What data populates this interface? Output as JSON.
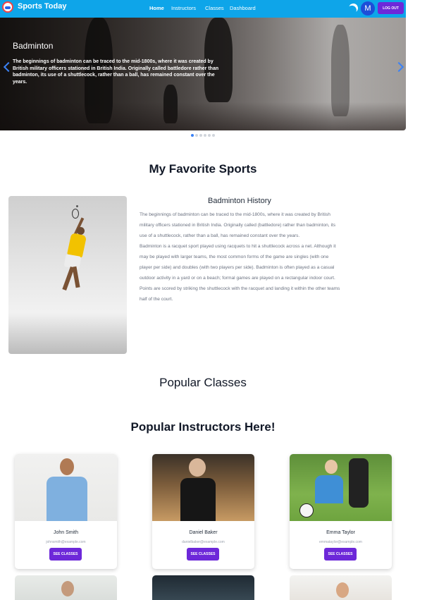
{
  "navbar": {
    "brand": "Sports Today",
    "links": [
      "Home",
      "Instructors",
      "Classes",
      "Dashboard"
    ],
    "avatar_letter": "M",
    "logout_label": "LOG OUT"
  },
  "hero": {
    "title": "Badminton",
    "text": "The beginnings of badminton can be traced to the mid-1800s, where it was created by British military officers stationed in British India. Originally called battledore rather than badminton, its use of a shuttlecock, rather than a ball, has remained constant over the years.",
    "slide_count": 6,
    "active_slide": 1
  },
  "favorite": {
    "heading": "My Favorite Sports",
    "history_title": "Badminton History",
    "paragraph1": "The beginnings of badminton can be traced to the mid-1800s, where it was created by British military officers stationed in British India. Originally called (battledore) rather than badminton, its use of a shuttlecock, rather than a ball, has remained constant over the years.",
    "paragraph2": "Badminton is a racquet sport played using racquets to hit a shuttlecock across a net. Although it may be played with larger teams, the most common forms of the game are singles (with one player per side) and doubles (with two players per side). Badminton is often played as a casual outdoor activity in a yard or on a beach; formal games are played on a rectangular indoor court. Points are scored by striking the shuttlecock with the racquet and landing it within the other teams half of the court."
  },
  "popular_classes": {
    "heading": "Popular Classes"
  },
  "instructors": {
    "heading": "Popular Instructors Here!",
    "button_label": "SEE CLASSES",
    "items": [
      {
        "name": "John Smith",
        "email": "johnsmith@example.com"
      },
      {
        "name": "Daniel Baker",
        "email": "danielbaker@example.com"
      },
      {
        "name": "Emma Taylor",
        "email": "emmataylor@example.com"
      }
    ]
  },
  "colors": {
    "navbar": "#0ea5e9",
    "button": "#6d28d9",
    "carousel_arrow": "#3b82f6"
  }
}
